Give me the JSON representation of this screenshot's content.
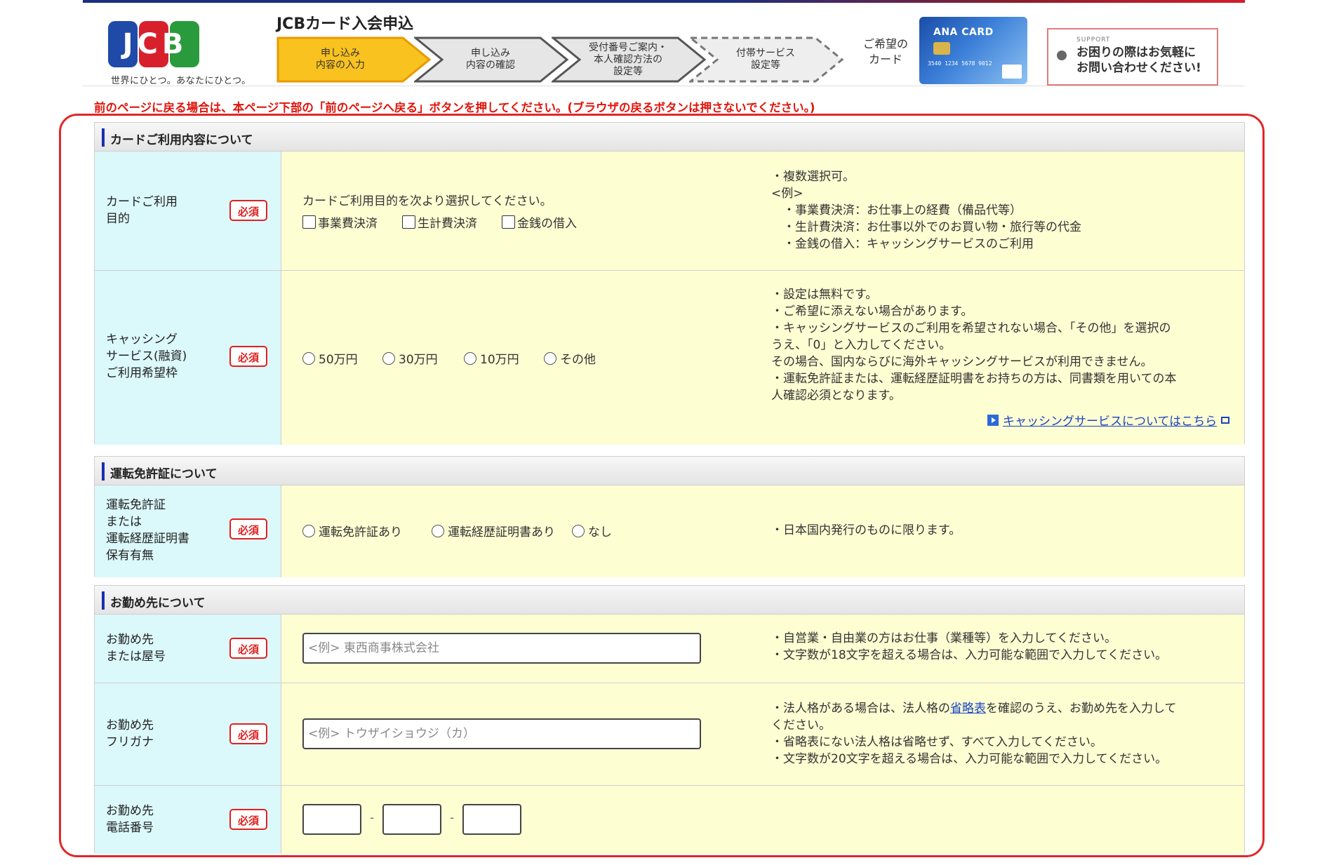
{
  "header": {
    "app_title": "JCBカード入会申込",
    "tagline": "世界にひとつ。あなたにひとつ。",
    "logo_text": "JCB",
    "steps": [
      {
        "label": "申し込み\n内容の入力",
        "state": "current"
      },
      {
        "label": "申し込み\n内容の確認",
        "state": "upcoming"
      },
      {
        "label": "受付番号ご案内・\n本人確認方法の\n設定等",
        "state": "upcoming"
      },
      {
        "label": "付帯サービス\n設定等",
        "state": "optional"
      }
    ],
    "wish_card_label": "ご希望の\nカード",
    "card_name": "ANA CARD",
    "card_number": "3540 1234 5678 9012",
    "support_small": "SUPPORT",
    "support_msg": "お困りの際はお気軽に\nお問い合わせください!"
  },
  "notice": "前のページに戻る場合は、本ページ下部の「前のページへ戻る」ボタンを押してください。(ブラウザの戻るボタンは押さないでください。)",
  "required_label": "必須",
  "sections": {
    "usage": {
      "title": "カードご利用内容について",
      "purpose": {
        "label": "カードご利用\n目的",
        "instruction": "カードご利用目的を次より選択してください。",
        "options": [
          "事業費決済",
          "生計費決済",
          "金銭の借入"
        ],
        "note": "・複数選択可。\n<例>\n　・事業費決済：お仕事上の経費（備品代等）\n　・生計費決済：お仕事以外でのお買い物・旅行等の代金\n　・金銭の借入：キャッシングサービスのご利用"
      },
      "cashing": {
        "label": "キャッシング\nサービス(融資)\nご利用希望枠",
        "options": [
          "50万円",
          "30万円",
          "10万円",
          "その他"
        ],
        "note": "・設定は無料です。\n・ご希望に添えない場合があります。\n・キャッシングサービスのご利用を希望されない場合、「その他」を選択の\nうえ、「0」と入力してください。\nその場合、国内ならびに海外キャッシングサービスが利用できません。\n・運転免許証または、運転経歴証明書をお持ちの方は、同書類を用いての本\n人確認必須となります。",
        "link": "キャッシングサービスについてはこちら"
      }
    },
    "license": {
      "title": "運転免許証について",
      "row": {
        "label": "運転免許証\nまたは\n運転経歴証明書\n保有有無",
        "options": [
          "運転免許証あり",
          "運転経歴証明書あり",
          "なし"
        ],
        "note": "・日本国内発行のものに限ります。"
      }
    },
    "work": {
      "title": "お勤め先について",
      "name": {
        "label": "お勤め先\nまたは屋号",
        "placeholder": "<例> 東西商事株式会社",
        "note": "・自営業・自由業の方はお仕事（業種等）を入力してください。\n・文字数が18文字を超える場合は、入力可能な範囲で入力してください。"
      },
      "kana": {
        "label": "お勤め先\nフリガナ",
        "placeholder": "<例> トウザイショウジ（カ）",
        "note_pre": "・法人格がある場合は、法人格の",
        "note_link": "省略表",
        "note_post": "を確認のうえ、お勤め先を入力して\nください。\n・省略表にない法人格は省略せず、すべて入力してください。\n・文字数が20文字を超える場合は、入力可能な範囲で入力してください。"
      },
      "phone": {
        "label": "お勤め先\n電話番号",
        "separator": "-"
      }
    }
  },
  "colors": {
    "label_bg": "#dbf8fb",
    "field_bg": "#fefed3",
    "required": "#e02020",
    "notice": "#e0140a",
    "step_current": "#f9c21f",
    "accent_bar": "#1a2fb0"
  }
}
